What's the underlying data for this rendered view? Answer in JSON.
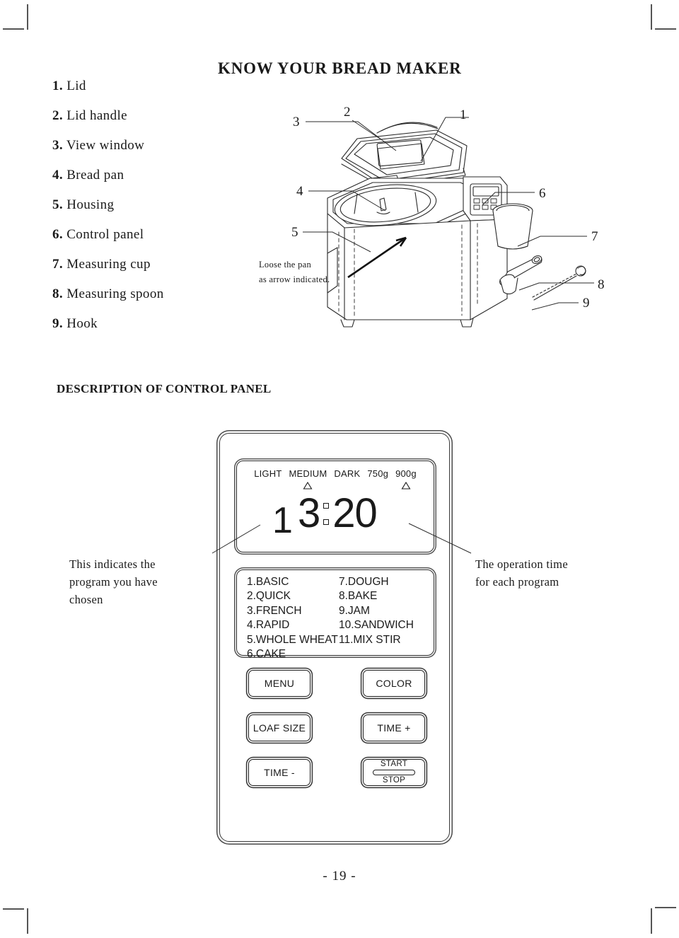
{
  "document": {
    "page_title": "KNOW YOUR BREAD MAKER",
    "section_title": "DESCRIPTION OF CONTROL PANEL",
    "page_number": "- 19 -"
  },
  "parts_list": [
    {
      "num": "1.",
      "label": "Lid"
    },
    {
      "num": "2.",
      "label": "Lid handle"
    },
    {
      "num": "3.",
      "label": "View window"
    },
    {
      "num": "4.",
      "label": "Bread pan"
    },
    {
      "num": "5.",
      "label": "Housing"
    },
    {
      "num": "6.",
      "label": "Control panel"
    },
    {
      "num": "7.",
      "label": "Measuring cup"
    },
    {
      "num": "8.",
      "label": "Measuring spoon"
    },
    {
      "num": "9.",
      "label": "Hook"
    }
  ],
  "diagram": {
    "callouts": [
      {
        "id": "1",
        "label": "1"
      },
      {
        "id": "2",
        "label": "2"
      },
      {
        "id": "3",
        "label": "3"
      },
      {
        "id": "4",
        "label": "4"
      },
      {
        "id": "5",
        "label": "5"
      },
      {
        "id": "6",
        "label": "6"
      },
      {
        "id": "7",
        "label": "7"
      },
      {
        "id": "8",
        "label": "8"
      },
      {
        "id": "9",
        "label": "9"
      }
    ],
    "note_line1": "Loose the pan",
    "note_line2": "as arrow indicated."
  },
  "control_panel": {
    "lcd": {
      "indicators": [
        {
          "label": "LIGHT",
          "marked": false
        },
        {
          "label": "MEDIUM",
          "marked": true
        },
        {
          "label": "DARK",
          "marked": false
        },
        {
          "label": "750g",
          "marked": false
        },
        {
          "label": "900g",
          "marked": true
        }
      ],
      "program_number": "1",
      "time_hour": "3",
      "time_minute": "20",
      "time_display": "3:20"
    },
    "programs_left": [
      "1.BASIC",
      "2.QUICK",
      "3.FRENCH",
      "4.RAPID",
      "5.WHOLE WHEAT",
      "6.CAKE"
    ],
    "programs_right": [
      "7.DOUGH",
      "8.BAKE",
      "9.JAM",
      "10.SANDWICH",
      "11.MIX STIR"
    ],
    "buttons": {
      "menu": "MENU",
      "color": "COLOR",
      "loaf_size": "LOAF SIZE",
      "time_plus": "TIME +",
      "time_minus": "TIME -",
      "start": "START",
      "stop": "STOP"
    }
  },
  "annotations": {
    "left_line1": "This indicates the",
    "left_line2": "program you have",
    "left_line3": "chosen",
    "right_line1": "The operation time",
    "right_line2": "for each program"
  }
}
